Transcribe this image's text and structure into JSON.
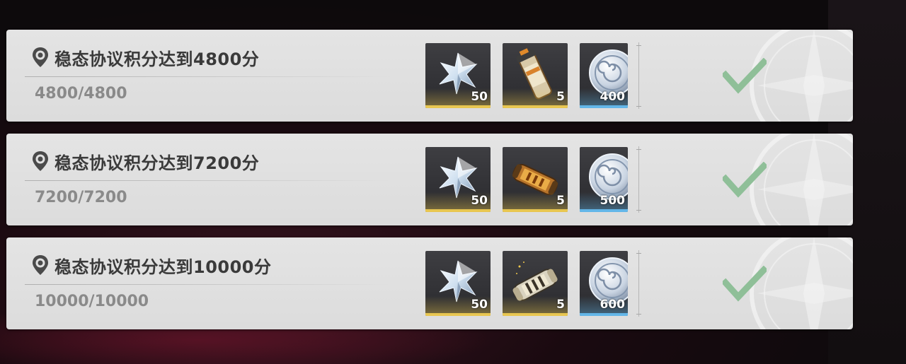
{
  "colors": {
    "gold_bar": "#e8c650",
    "blue_bar": "#63b6e8",
    "check": "#8fbf98",
    "title": "#3a3a3a",
    "progress": "#8a8a8a"
  },
  "missions": [
    {
      "title": "稳态协议积分达到4800分",
      "progress": "4800/4800",
      "completed_icon": "check-icon",
      "rewards": [
        {
          "icon": "crystal-star-icon",
          "count": "50",
          "rarity": "gold"
        },
        {
          "icon": "fuel-canister-icon",
          "count": "5",
          "rarity": "gold"
        },
        {
          "icon": "silver-coin-icon",
          "count": "400",
          "rarity": "blue"
        }
      ]
    },
    {
      "title": "稳态协议积分达到7200分",
      "progress": "7200/7200",
      "completed_icon": "check-icon",
      "rewards": [
        {
          "icon": "crystal-star-icon",
          "count": "50",
          "rarity": "gold"
        },
        {
          "icon": "amber-capsule-icon",
          "count": "5",
          "rarity": "gold"
        },
        {
          "icon": "silver-coin-icon",
          "count": "500",
          "rarity": "blue"
        }
      ]
    },
    {
      "title": "稳态协议积分达到10000分",
      "progress": "10000/10000",
      "completed_icon": "check-icon",
      "rewards": [
        {
          "icon": "crystal-star-icon",
          "count": "50",
          "rarity": "gold"
        },
        {
          "icon": "golden-capsule-icon",
          "count": "5",
          "rarity": "gold"
        },
        {
          "icon": "silver-coin-icon",
          "count": "600",
          "rarity": "blue"
        }
      ]
    }
  ]
}
